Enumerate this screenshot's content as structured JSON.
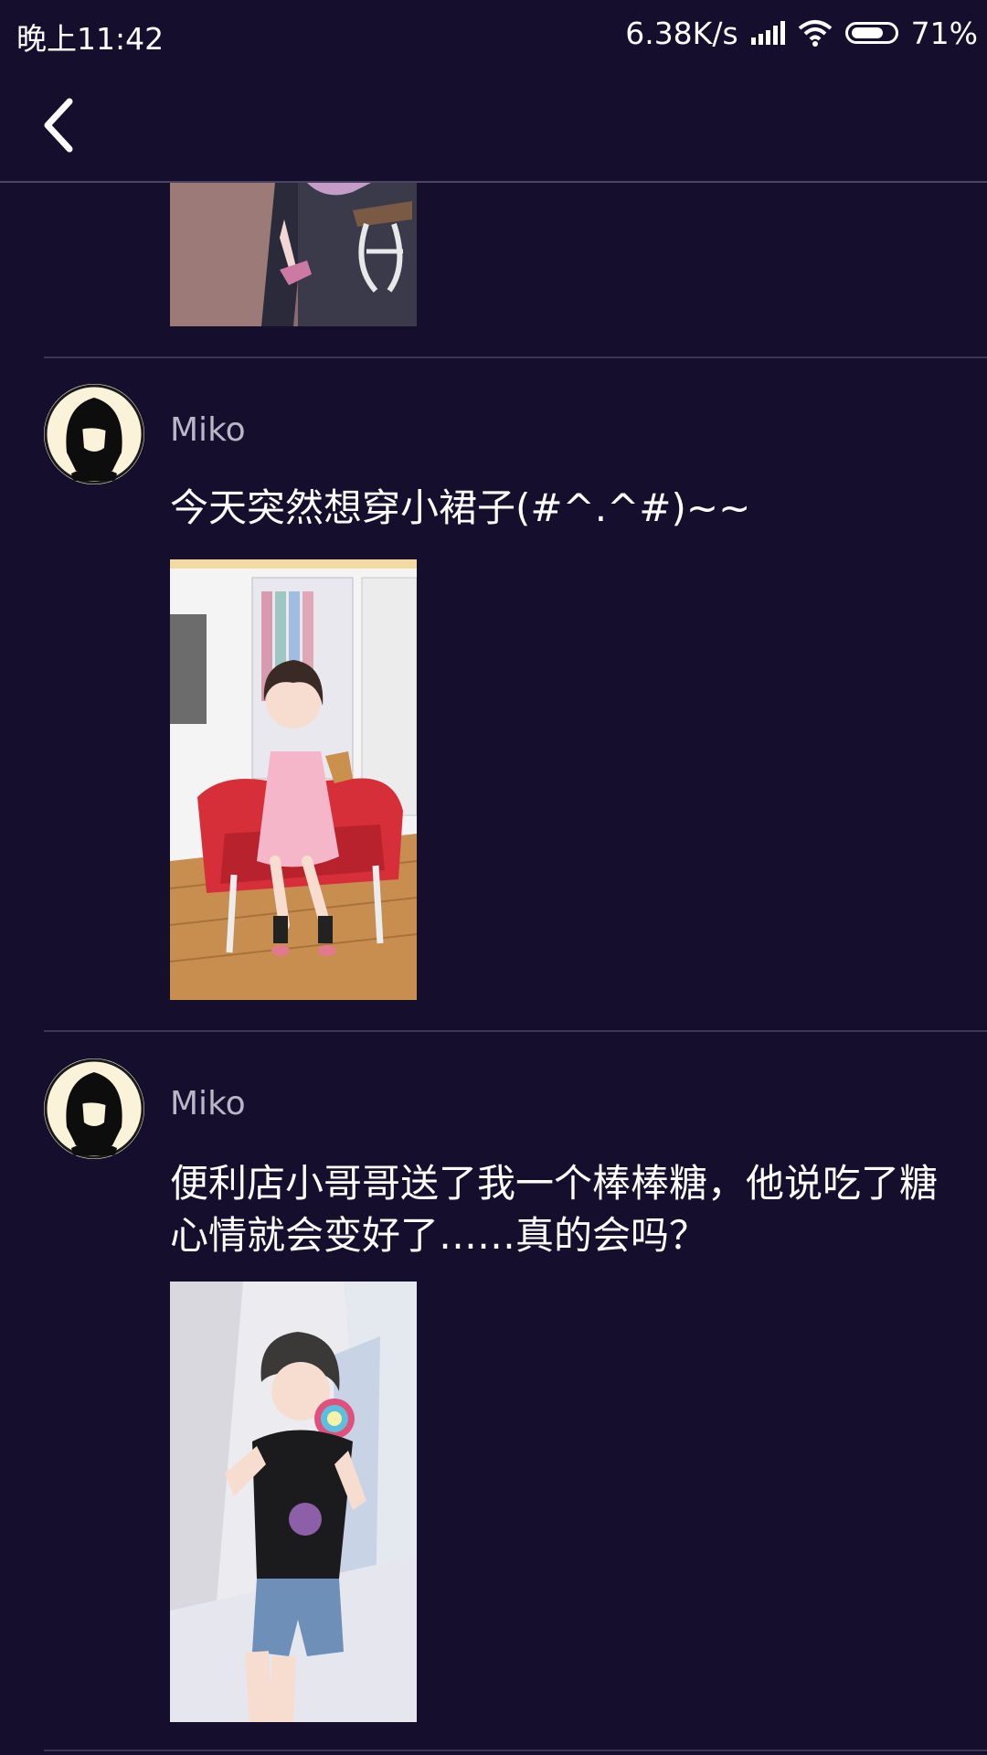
{
  "status_bar": {
    "time": "晚上11:42",
    "speed": "6.38K/s",
    "battery": "71%",
    "icons": [
      "signal-icon",
      "wifi-icon",
      "battery-icon"
    ]
  },
  "header": {
    "back_icon": "chevron-left-icon"
  },
  "posts": [
    {
      "username": "Miko",
      "text": "今天突然想穿小裙子(#^.^#)~~"
    },
    {
      "username": "Miko",
      "text": "便利店小哥哥送了我一个棒棒糖，他说吃了糖心情就会变好了……真的会吗？"
    }
  ],
  "colors": {
    "background": "#150f2d",
    "divider": "#3b3652",
    "username": "#b9b6c8"
  }
}
